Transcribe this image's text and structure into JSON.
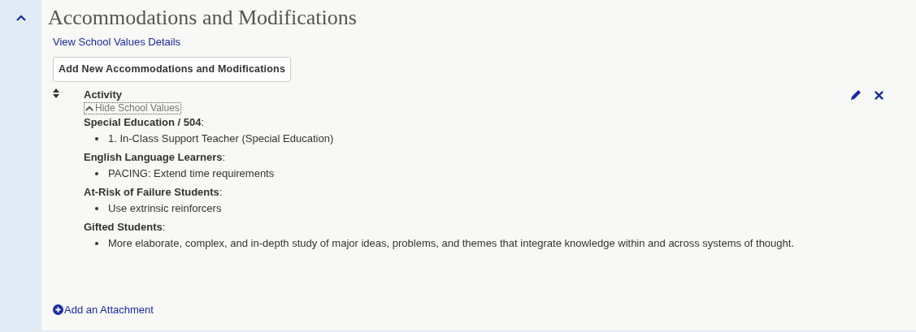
{
  "section": {
    "title": "Accommodations and Modifications",
    "expanded": true,
    "details_link": "View School Values Details",
    "add_button": "Add New Accommodations and Modifications",
    "attachment_link": "Add an Attachment"
  },
  "item": {
    "name": "Activity",
    "values_toggle": {
      "label": "Hide School Values",
      "expanded": true
    },
    "groups": [
      {
        "heading": "**Special Education / 504**:",
        "entries": [
          "1. In-Class Support Teacher (Special Education)"
        ]
      },
      {
        "heading": "**English Language Learners**:",
        "entries": [
          "PACING: Extend time requirements"
        ]
      },
      {
        "heading": "**At-Risk of Failure Students**:",
        "entries": [
          "Use extrinsic reinforcers"
        ]
      },
      {
        "heading": "**Gifted Students**:",
        "entries": [
          "More elaborate, complex, and in-depth study of major ideas, problems, and themes that integrate knowledge within and across systems of thought."
        ]
      }
    ]
  }
}
